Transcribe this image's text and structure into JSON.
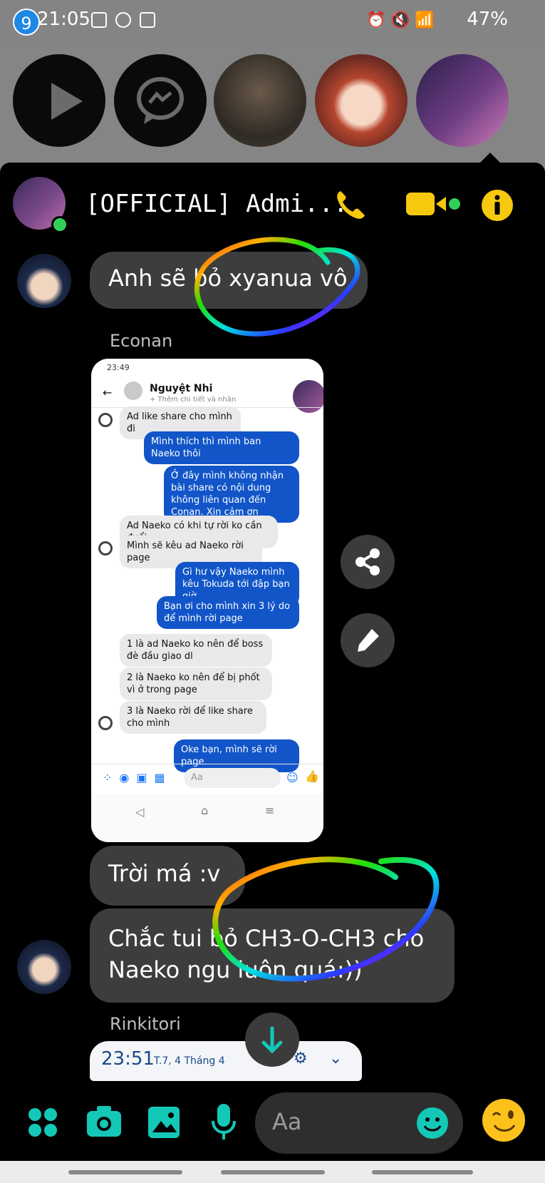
{
  "status_bar": {
    "time": "21:05",
    "battery": "47%"
  },
  "chat_heads": {
    "badge_count": "9"
  },
  "header": {
    "title": "[OFFICIAL] Admi..."
  },
  "messages": {
    "m1": "Anh sẽ bỏ xyanua vô",
    "sender_econan": "Econan",
    "m2": "Trời má :v",
    "m3": "Chắc tui bỏ CH3-O-CH3 cho Naeko ngu luôn quá:))",
    "sender_rinkitori": "Rinkitori"
  },
  "embedded_screenshot": {
    "status_time": "23:49",
    "contact_name": "Nguyệt Nhi",
    "contact_sub": "+ Thêm chi tiết và nhãn",
    "items": [
      {
        "side": "in",
        "text": "Ad like share cho mình đi"
      },
      {
        "side": "out",
        "text": "Mình thích thì mình ban Naeko thôi"
      },
      {
        "side": "out",
        "text": "Ở đây mình không nhận bài share có nội dung không liên quan đến Conan. Xin cảm ơn"
      },
      {
        "side": "in",
        "text": "Ad Naeko có khi tự rời ko cần đuổi"
      },
      {
        "side": "in",
        "text": "Mình sẽ kêu ad Naeko rời page"
      },
      {
        "side": "out",
        "text": "Gì hư vậy Naeko mình kêu Tokuda tới đập bạn giờ"
      },
      {
        "side": "out",
        "text": "Bạn ơi cho mình xin 3 lý do để mình rời page"
      },
      {
        "side": "in",
        "text": "1 là ad Naeko ko nên để boss đè đầu giao dl"
      },
      {
        "side": "in",
        "text": "2 là Naeko ko nên để bị phốt vì ở trong page"
      },
      {
        "side": "in",
        "text": "3 là Naeko rời để like share cho mình"
      },
      {
        "side": "out",
        "text": "Oke bạn, mình sẽ rời page"
      }
    ],
    "composer_placeholder": "Aa"
  },
  "notification_peek": {
    "time": "23:51",
    "date": "T.7, 4 Tháng 4"
  },
  "composer": {
    "placeholder": "Aa"
  },
  "colors": {
    "accent_yellow": "#f6c90e",
    "accent_teal": "#14c8b8",
    "bubble_gray": "#3d3d3d",
    "messenger_blue": "#1155c8"
  },
  "icons": [
    "play-icon",
    "messenger-icon",
    "phone-icon",
    "video-icon",
    "info-icon",
    "share-icon",
    "edit-icon",
    "scroll-down-icon",
    "apps-icon",
    "camera-icon",
    "gallery-icon",
    "mic-icon",
    "emoji-icon",
    "wink-emoji-icon"
  ]
}
